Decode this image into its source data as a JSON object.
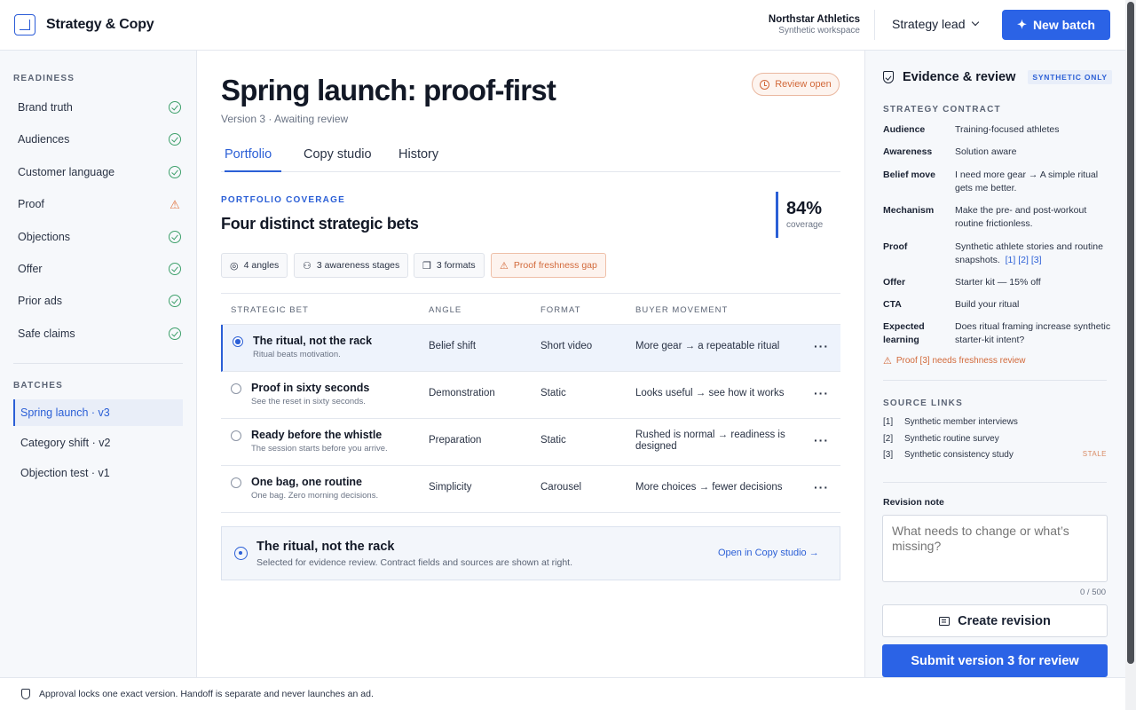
{
  "app": {
    "title": "Strategy & Copy",
    "org_name": "Northstar Athletics",
    "org_sub": "Synthetic workspace",
    "role": "Strategy lead",
    "new_batch": "New batch"
  },
  "sidebar": {
    "readiness_label": "READINESS",
    "readiness": [
      {
        "label": "Brand truth",
        "status": "ok"
      },
      {
        "label": "Audiences",
        "status": "ok"
      },
      {
        "label": "Customer language",
        "status": "ok"
      },
      {
        "label": "Proof",
        "status": "warning"
      },
      {
        "label": "Objections",
        "status": "ok"
      },
      {
        "label": "Offer",
        "status": "ok"
      },
      {
        "label": "Prior ads",
        "status": "ok"
      },
      {
        "label": "Safe claims",
        "status": "ok"
      }
    ],
    "batches_label": "BATCHES",
    "batches": [
      {
        "label": "Spring launch · v3",
        "active": true
      },
      {
        "label": "Category shift · v2",
        "active": false
      },
      {
        "label": "Objection test · v1",
        "active": false
      }
    ]
  },
  "main": {
    "title": "Spring launch: proof-first",
    "version": "Version 3 · Awaiting review",
    "status_pill": "Review open",
    "tabs": [
      "Portfolio",
      "Copy studio",
      "History"
    ],
    "active_tab": "Portfolio",
    "coverage_label": "PORTFOLIO COVERAGE",
    "coverage_title": "Four distinct strategic bets",
    "coverage_value": "84%",
    "coverage_sub": "coverage",
    "chips": [
      {
        "label": "4 angles",
        "icon": "target-icon"
      },
      {
        "label": "3 awareness stages",
        "icon": "users-icon"
      },
      {
        "label": "3 formats",
        "icon": "copy-icon"
      },
      {
        "label": "Proof freshness gap",
        "icon": "warning-icon"
      }
    ],
    "table": {
      "headers": [
        "STRATEGIC BET",
        "ANGLE",
        "FORMAT",
        "BUYER MOVEMENT"
      ],
      "rows": [
        {
          "name": "The ritual, not the rack",
          "sub": "Ritual beats motivation.",
          "angle": "Belief shift",
          "format": "Short video",
          "movement": "More gear → a repeatable ritual",
          "selected": true
        },
        {
          "name": "Proof in sixty seconds",
          "sub": "See the reset in sixty seconds.",
          "angle": "Demonstration",
          "format": "Static",
          "movement": "Looks useful → see how it works",
          "selected": false
        },
        {
          "name": "Ready before the whistle",
          "sub": "The session starts before you arrive.",
          "angle": "Preparation",
          "format": "Static",
          "movement": "Rushed is normal → readiness is designed",
          "selected": false
        },
        {
          "name": "One bag, one routine",
          "sub": "One bag. Zero morning decisions.",
          "angle": "Simplicity",
          "format": "Carousel",
          "movement": "More choices → fewer decisions",
          "selected": false
        }
      ]
    },
    "selection": {
      "title": "The ritual, not the rack",
      "sub": "Selected for evidence review. Contract fields and sources are shown at right.",
      "link": "Open in Copy studio →"
    }
  },
  "panel": {
    "title": "Evidence & review",
    "badge": "SYNTHETIC ONLY",
    "contract_label": "STRATEGY CONTRACT",
    "contract": [
      {
        "key": "Audience",
        "value": "Training-focused athletes"
      },
      {
        "key": "Awareness",
        "value": "Solution aware"
      },
      {
        "key": "Belief move",
        "value": "I need more gear → A simple ritual gets me better."
      },
      {
        "key": "Mechanism",
        "value": "Make the pre- and post-workout routine frictionless."
      },
      {
        "key": "Proof",
        "value": "Synthetic athlete stories and routine snapshots.",
        "refs": "[1] [2] [3]"
      },
      {
        "key": "Offer",
        "value": "Starter kit — 15% off"
      },
      {
        "key": "CTA",
        "value": "Build your ritual"
      },
      {
        "key": "Expected learning",
        "value": "Does ritual framing increase synthetic starter-kit intent?"
      }
    ],
    "warning": "Proof [3] needs freshness review",
    "sources_label": "SOURCE LINKS",
    "sources": [
      {
        "num": "[1]",
        "label": "Synthetic member interviews",
        "flag": ""
      },
      {
        "num": "[2]",
        "label": "Synthetic routine survey",
        "flag": ""
      },
      {
        "num": "[3]",
        "label": "Synthetic consistency study",
        "flag": "STALE"
      }
    ],
    "revision_label": "Revision note",
    "revision_placeholder": "What needs to change or what’s missing?",
    "counter": "0 / 500",
    "create_revision": "Create revision",
    "submit": "Submit version 3 for review"
  },
  "footer": {
    "text": "Approval locks one exact version. Handoff is separate and never launches an ad."
  },
  "colors": {
    "accent": "#2b63e6",
    "ok": "#3ea06b",
    "warning": "#d2693a"
  }
}
